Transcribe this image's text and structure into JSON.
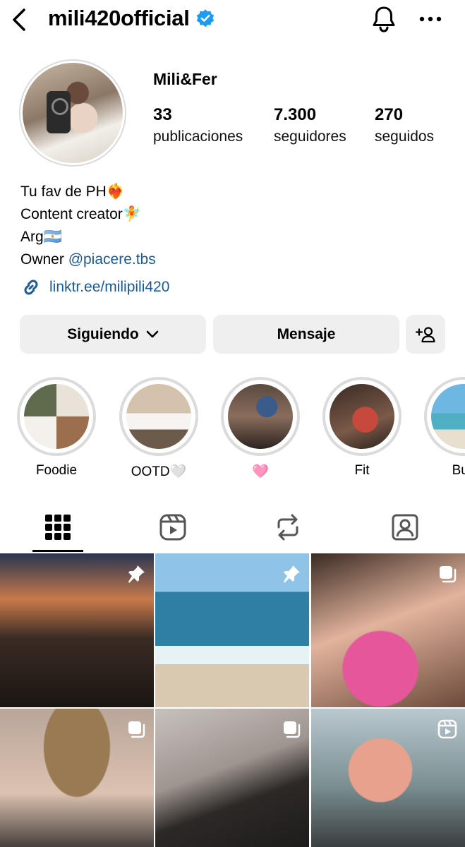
{
  "header": {
    "username": "mili420official",
    "icons": {
      "back": "chevron-left-icon",
      "verified": "verified-badge-icon",
      "notifications": "bell-icon",
      "more": "more-horizontal-icon"
    },
    "colors": {
      "verified": "#1d9bf0"
    }
  },
  "profile": {
    "display_name": "Mili&Fer",
    "stats": [
      {
        "value": "33",
        "label": "publicaciones"
      },
      {
        "value": "7.300",
        "label": "seguidores"
      },
      {
        "value": "270",
        "label": "seguidos"
      }
    ],
    "bio": {
      "line1": "Tu fav de PH❤️‍🔥",
      "line2": "Content creator🧚",
      "line3": "Arg🇦🇷",
      "line4_prefix": "Owner ",
      "line4_mention": "@piacere.tbs"
    },
    "link": "linktr.ee/milipili420",
    "link_color": "#1a5a96"
  },
  "actions": {
    "following_label": "Siguiendo",
    "message_label": "Mensaje",
    "add_user_icon": "add-user-icon",
    "button_bg": "#efefef"
  },
  "highlights": [
    {
      "label": "Foodie"
    },
    {
      "label": "OOTD🤍"
    },
    {
      "label": "🩷"
    },
    {
      "label": "Fit"
    },
    {
      "label": "Buz"
    }
  ],
  "tabs": [
    {
      "name": "grid",
      "icon": "grid-icon",
      "active": true
    },
    {
      "name": "reels",
      "icon": "reels-icon",
      "active": false
    },
    {
      "name": "reposts",
      "icon": "repost-icon",
      "active": false
    },
    {
      "name": "tagged",
      "icon": "tagged-user-icon",
      "active": false
    }
  ],
  "posts": [
    {
      "badge": "pin-icon"
    },
    {
      "badge": "pin-icon"
    },
    {
      "badge": "carousel-icon"
    },
    {
      "badge": "carousel-icon"
    },
    {
      "badge": "carousel-icon"
    },
    {
      "badge": "reel-icon"
    }
  ]
}
